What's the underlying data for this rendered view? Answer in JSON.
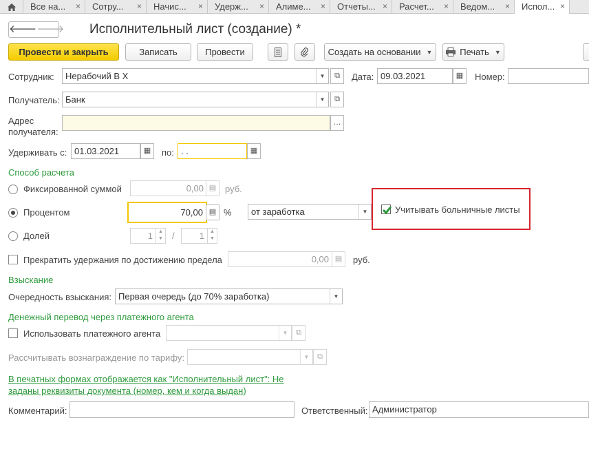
{
  "tabs": [
    {
      "label": "Все на..."
    },
    {
      "label": "Сотру..."
    },
    {
      "label": "Начис..."
    },
    {
      "label": "Удерж..."
    },
    {
      "label": "Алиме..."
    },
    {
      "label": "Отчеты..."
    },
    {
      "label": "Расчет..."
    },
    {
      "label": "Ведом..."
    },
    {
      "label": "Испол..."
    }
  ],
  "title": "Исполнительный лист (создание) *",
  "toolbar": {
    "post_close": "Провести и закрыть",
    "save": "Записать",
    "post": "Провести",
    "create_based": "Создать на основании",
    "print": "Печать"
  },
  "employee": {
    "label": "Сотрудник:",
    "value": "Нерабочий В Х"
  },
  "date": {
    "label": "Дата:",
    "value": "09.03.2021"
  },
  "number": {
    "label": "Номер:",
    "value": ""
  },
  "recipient": {
    "label": "Получатель:",
    "value": "Банк"
  },
  "recipient_address": {
    "label_line1": "Адрес",
    "label_line2": "получателя:",
    "value": ""
  },
  "withhold_from": {
    "label": "Удерживать с:",
    "value": "01.03.2021"
  },
  "withhold_to": {
    "label": "по:",
    "value": " .  ."
  },
  "calc_method": {
    "section": "Способ расчета",
    "fixed_label": "Фиксированной суммой",
    "fixed_value": "0,00",
    "fixed_unit": "руб.",
    "percent_label": "Процентом",
    "percent_value": "70,00",
    "percent_unit": "%",
    "percent_base": "от заработка",
    "share_label": "Долей",
    "share_num": "1",
    "share_sep": "/",
    "share_den": "1",
    "sick_leave_label": "Учитывать больничные листы",
    "sick_leave_checked": true
  },
  "limit": {
    "label": "Прекратить удержания по достижению предела",
    "value": "0,00",
    "unit": "руб."
  },
  "collection": {
    "section": "Взыскание",
    "priority_label": "Очередность взыскания:",
    "priority_value": "Первая очередь (до 70% заработка)"
  },
  "agent": {
    "section": "Денежный перевод через платежного агента",
    "use_label": "Использовать платежного агента",
    "fee_label": "Рассчитывать вознаграждение по тарифу:"
  },
  "print_link": {
    "line1": "В печатных формах отображается как \"Исполнительный лист\": Не",
    "line2": "заданы реквизиты документа (номер, кем и когда выдан)"
  },
  "comment": {
    "label": "Комментарий:",
    "value": ""
  },
  "responsible": {
    "label": "Ответственный:",
    "value": "Администратор"
  }
}
